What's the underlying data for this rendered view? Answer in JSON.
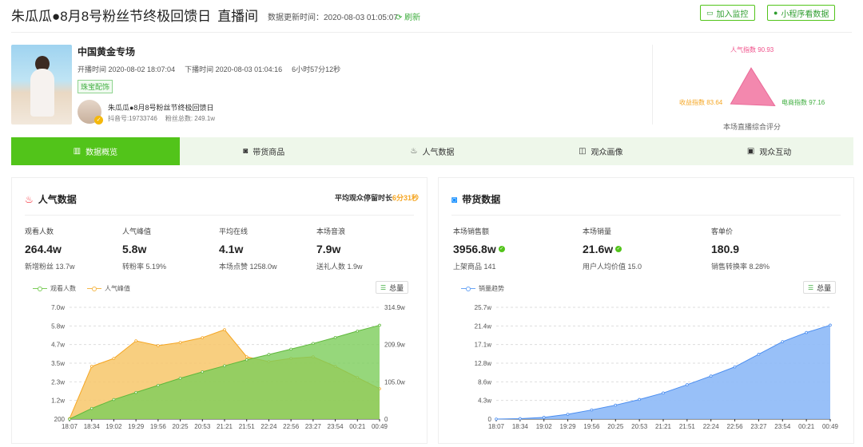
{
  "header": {
    "title": "朱瓜瓜●8月8号粉丝节终极回馈日",
    "title_suffix": "直播间",
    "update_time": "数据更新时间：2020-08-03 01:05:07",
    "refresh_label": "刷新",
    "monitor_button": "加入监控",
    "miniprogram_button": "小程序看数据"
  },
  "room": {
    "name": "中国黄金专场",
    "start_time": "开播时间 2020-08-02 18:07:04",
    "end_time": "下播时间 2020-08-03 01:04:16",
    "duration": "6小时57分12秒",
    "tag": "珠宝配饰",
    "anchor_name": "朱瓜瓜●8月8号粉丝节终极回馈日",
    "douyin_id": "抖音号:19733746",
    "fans": "粉丝总数: 249.1w"
  },
  "radar": {
    "popularity": "人气指数 90.93",
    "income": "收益指数 83.64",
    "ecommerce": "电商指数 97.16",
    "caption": "本场直播综合评分",
    "values": {
      "popularity": 90.93,
      "income": 83.64,
      "ecommerce": 97.16
    },
    "colors": {
      "fill": "#f27ca6",
      "text_pop": "#f0508a",
      "text_income": "#f5a623",
      "text_ecom": "#3fae3f"
    }
  },
  "tabs": [
    {
      "label": "数据概览",
      "icon": "bar-chart-icon",
      "glyph": "▥"
    },
    {
      "label": "带货商品",
      "icon": "shopping-bag-icon",
      "glyph": "◙"
    },
    {
      "label": "人气数据",
      "icon": "fire-icon",
      "glyph": "♨"
    },
    {
      "label": "观众画像",
      "icon": "portrait-icon",
      "glyph": "◫"
    },
    {
      "label": "观众互动",
      "icon": "chat-icon",
      "glyph": "▣"
    }
  ],
  "popularity_panel": {
    "title": "人气数据",
    "stay_label": "平均观众停留时长",
    "stay_value": "6分31秒",
    "metrics": [
      {
        "label": "观看人数",
        "value": "264.4w",
        "sub": "新增粉丝 13.7w"
      },
      {
        "label": "人气峰值",
        "value": "5.8w",
        "sub": "转粉率 5.19%"
      },
      {
        "label": "平均在线",
        "value": "4.1w",
        "sub": "本场点赞 1258.0w"
      },
      {
        "label": "本场音浪",
        "value": "7.9w",
        "sub": "送礼人数 1.9w"
      }
    ],
    "legend": [
      "观看人数",
      "人气峰值"
    ],
    "total_label": "总量"
  },
  "sales_panel": {
    "title": "带货数据",
    "metrics": [
      {
        "label": "本场销售额",
        "value": "3956.8w",
        "sub": "上架商品 141",
        "verified": true
      },
      {
        "label": "本场销量",
        "value": "21.6w",
        "sub": "用户人均价值 15.0",
        "verified": true
      },
      {
        "label": "客单价",
        "value": "180.9",
        "sub": "销售转换率 8.28%",
        "verified": false
      }
    ],
    "legend": [
      "销量趋势"
    ],
    "total_label": "总量"
  },
  "chart_data": [
    {
      "type": "area",
      "x": [
        "18:07",
        "18:34",
        "19:02",
        "19:29",
        "19:56",
        "20:25",
        "20:53",
        "21:21",
        "21:51",
        "22:24",
        "22:56",
        "23:27",
        "23:54",
        "00:21",
        "00:49"
      ],
      "yticks_left": [
        "200",
        "1.2w",
        "2.3w",
        "3.5w",
        "4.7w",
        "5.8w",
        "7.0w"
      ],
      "yticks_right": [
        "0",
        "105.0w",
        "209.9w",
        "314.9w"
      ],
      "ylim_left": [
        200,
        70000
      ],
      "ylim_right": [
        0,
        3149000
      ],
      "series": [
        {
          "name": "观看人数",
          "axis": "right",
          "color": "#7ccd5a",
          "values": [
            0,
            0.3,
            0.55,
            0.75,
            0.95,
            1.15,
            1.33,
            1.5,
            1.67,
            1.82,
            1.97,
            2.13,
            2.3,
            2.48,
            2.644
          ]
        },
        {
          "name": "人气峰值",
          "axis": "left",
          "color": "#f5b84a",
          "values": [
            0.02,
            3.3,
            3.8,
            4.9,
            4.6,
            4.8,
            5.1,
            5.6,
            3.9,
            3.6,
            3.8,
            3.9,
            3.3,
            2.6,
            1.9
          ]
        }
      ]
    },
    {
      "type": "area",
      "x": [
        "18:07",
        "18:34",
        "19:02",
        "19:29",
        "19:56",
        "20:25",
        "20:53",
        "21:21",
        "21:51",
        "22:24",
        "22:56",
        "23:27",
        "23:54",
        "00:21",
        "00:49"
      ],
      "yticks": [
        "0",
        "4.3w",
        "8.6w",
        "12.8w",
        "17.1w",
        "21.4w",
        "25.7w"
      ],
      "ylim": [
        0,
        257000
      ],
      "series": [
        {
          "name": "销量趋势",
          "color": "#6aa5f5",
          "values": [
            0,
            0.1,
            0.4,
            1.1,
            2.1,
            3.2,
            4.5,
            6.0,
            7.9,
            9.9,
            12.0,
            14.9,
            17.8,
            19.9,
            21.6
          ]
        }
      ]
    }
  ]
}
